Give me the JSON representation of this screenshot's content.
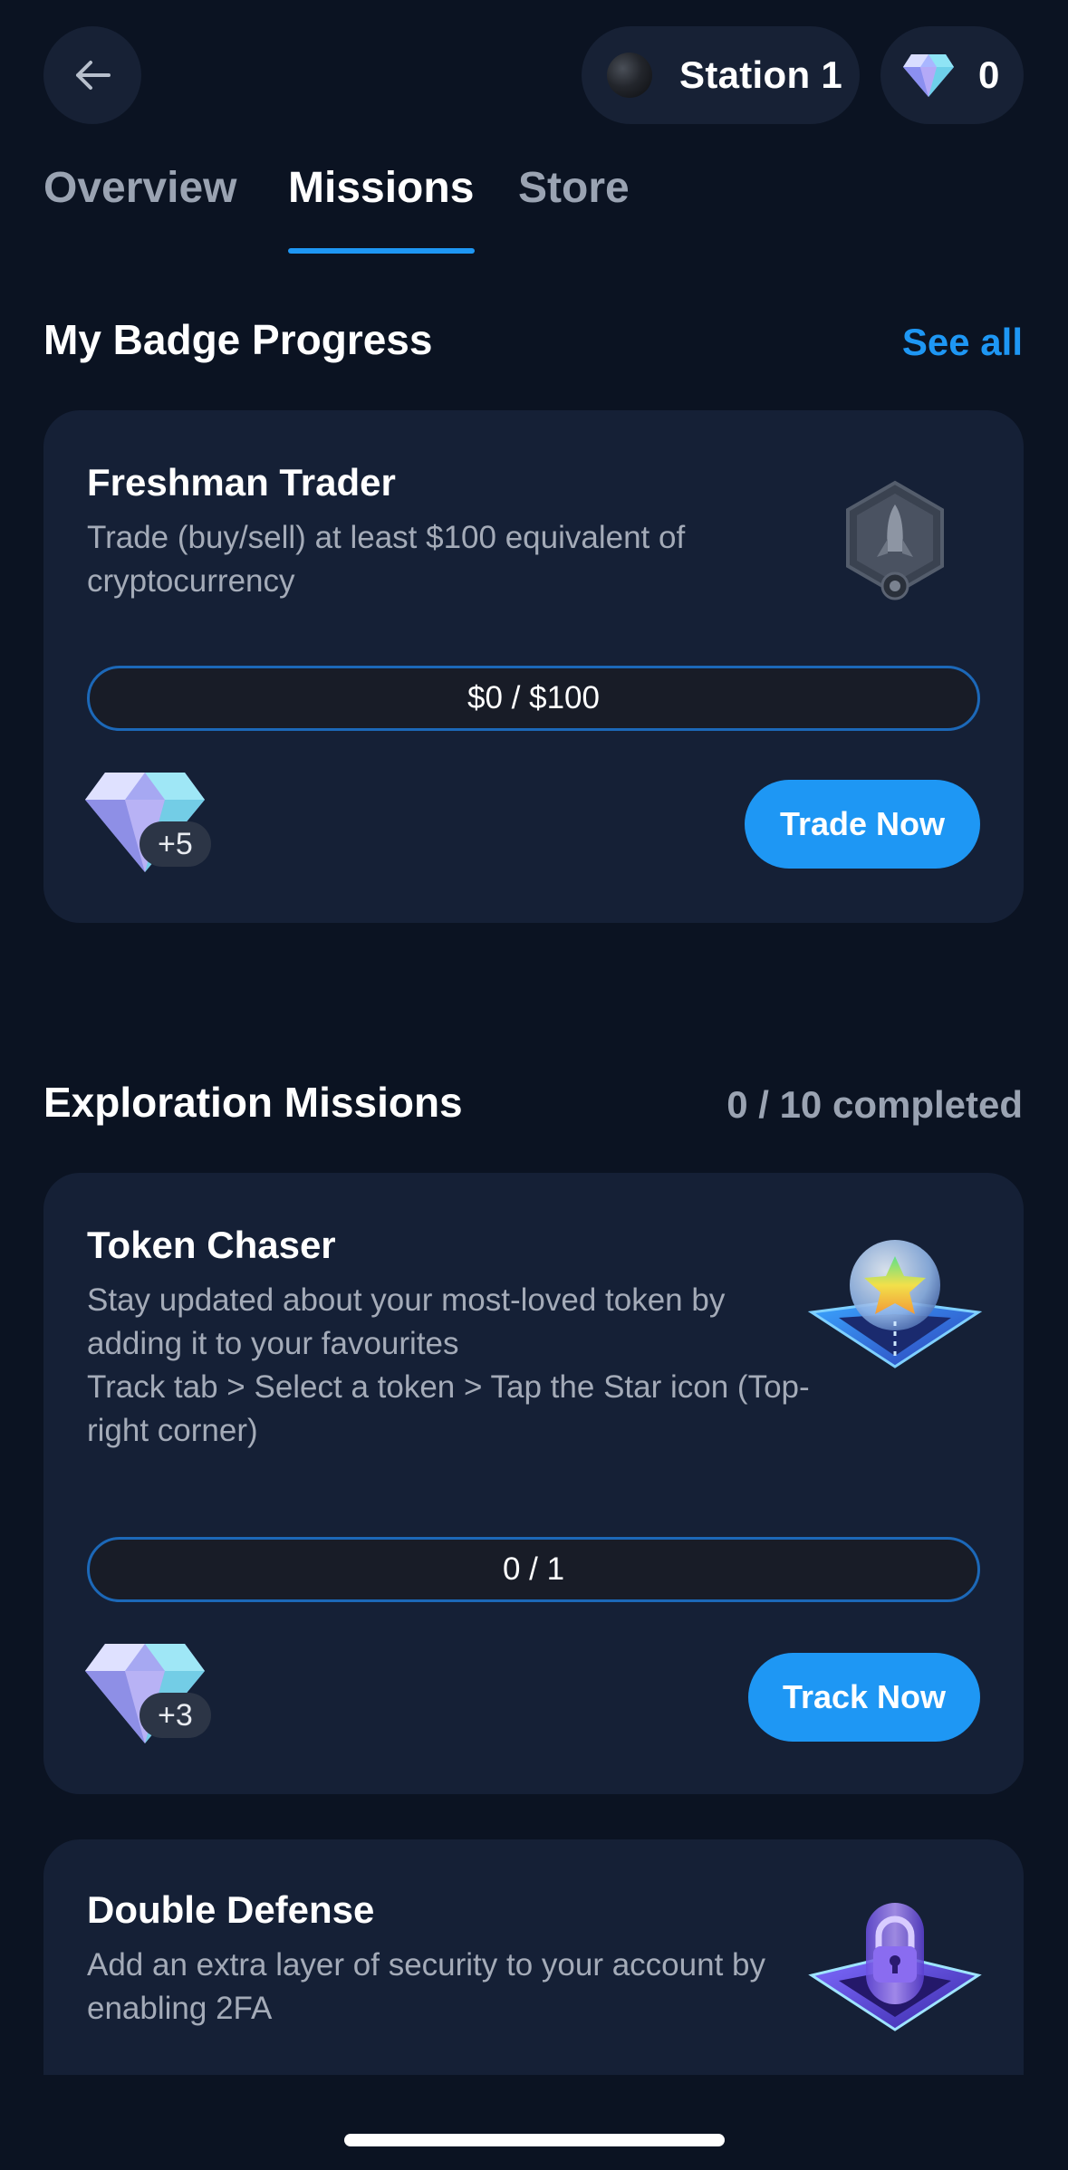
{
  "header": {
    "station_name": "Station 1",
    "gem_count": "0"
  },
  "tabs": [
    {
      "label": "Overview",
      "active": false
    },
    {
      "label": "Missions",
      "active": true
    },
    {
      "label": "Store",
      "active": false
    }
  ],
  "badge_progress": {
    "title": "My Badge Progress",
    "see_all": "See all",
    "card": {
      "title": "Freshman Trader",
      "description": "Trade (buy/sell) at least $100 equivalent of cryptocurrency",
      "progress_text": "$0 / $100",
      "progress_fraction": 0,
      "reward": "+5",
      "cta": "Trade Now",
      "icon": "rocket-badge-icon"
    }
  },
  "exploration": {
    "title": "Exploration Missions",
    "completed": "0 / 10 completed",
    "missions": [
      {
        "title": "Token Chaser",
        "description": "Stay updated about your most-loved token by adding it to your favourites",
        "steps": "Track tab > Select a token > Tap the Star icon (Top-right corner)",
        "progress_text": "0 / 1",
        "progress_fraction": 0,
        "reward": "+3",
        "cta": "Track Now",
        "icon": "star-orb-icon"
      },
      {
        "title": "Double Defense",
        "description": "Add an extra layer of security to your account by enabling 2FA",
        "icon": "padlock-icon"
      }
    ]
  },
  "colors": {
    "background": "#0b1322",
    "card": "#152036",
    "accent": "#1e97f4",
    "muted_text": "#a4abb8"
  }
}
